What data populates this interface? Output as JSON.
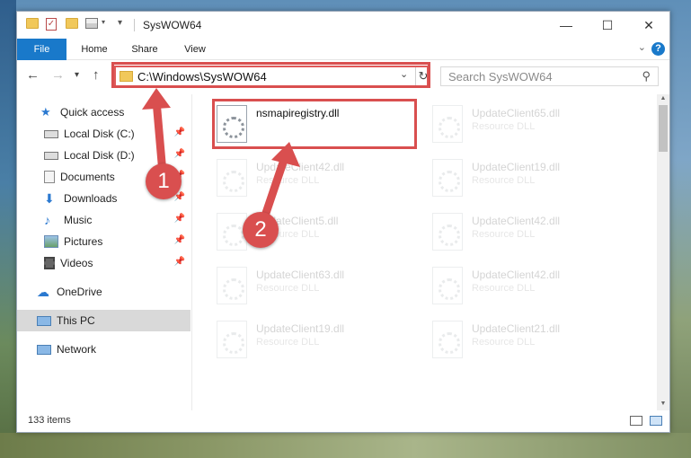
{
  "window": {
    "title": "SysWOW64"
  },
  "ribbon": {
    "tabs": [
      "File",
      "Home",
      "Share",
      "View"
    ],
    "help": "?"
  },
  "address": {
    "path": "C:\\Windows\\SysWOW64",
    "search_placeholder": "Search SysWOW64"
  },
  "sidebar": {
    "items": [
      {
        "label": "Quick access",
        "icon": "star-icon"
      },
      {
        "label": "Local Disk (C:)",
        "icon": "drive-icon",
        "pinned": true
      },
      {
        "label": "Local Disk (D:)",
        "icon": "drive-icon",
        "pinned": true
      },
      {
        "label": "Documents",
        "icon": "documents-icon",
        "pinned": true
      },
      {
        "label": "Downloads",
        "icon": "download-icon",
        "pinned": true
      },
      {
        "label": "Music",
        "icon": "music-icon",
        "pinned": true
      },
      {
        "label": "Pictures",
        "icon": "pictures-icon",
        "pinned": true
      },
      {
        "label": "Videos",
        "icon": "videos-icon",
        "pinned": true
      },
      {
        "label": "OneDrive",
        "icon": "cloud-icon"
      },
      {
        "label": "This PC",
        "icon": "computer-icon",
        "selected": true
      },
      {
        "label": "Network",
        "icon": "network-icon"
      }
    ]
  },
  "files": [
    {
      "name": "nsmapiregistry.dll",
      "type": "",
      "faded": false
    },
    {
      "name": "UpdateClient65.dll",
      "type": "Resource DLL",
      "faded": true
    },
    {
      "name": "UpdateClient42.dll",
      "type": "Resource DLL",
      "faded": true
    },
    {
      "name": "UpdateClient19.dll",
      "type": "Resource DLL",
      "faded": true
    },
    {
      "name": "UpdateClient5.dll",
      "type": "Resource DLL",
      "faded": true
    },
    {
      "name": "UpdateClient42.dll",
      "type": "Resource DLL",
      "faded": true
    },
    {
      "name": "UpdateClient63.dll",
      "type": "Resource DLL",
      "faded": true
    },
    {
      "name": "UpdateClient42.dll",
      "type": "Resource DLL",
      "faded": true
    },
    {
      "name": "UpdateClient19.dll",
      "type": "Resource DLL",
      "faded": true
    },
    {
      "name": "UpdateClient21.dll",
      "type": "Resource DLL",
      "faded": true
    }
  ],
  "status": {
    "count": "133 items"
  },
  "annotations": {
    "step1": "1",
    "step2": "2",
    "color": "#d94f4f"
  }
}
